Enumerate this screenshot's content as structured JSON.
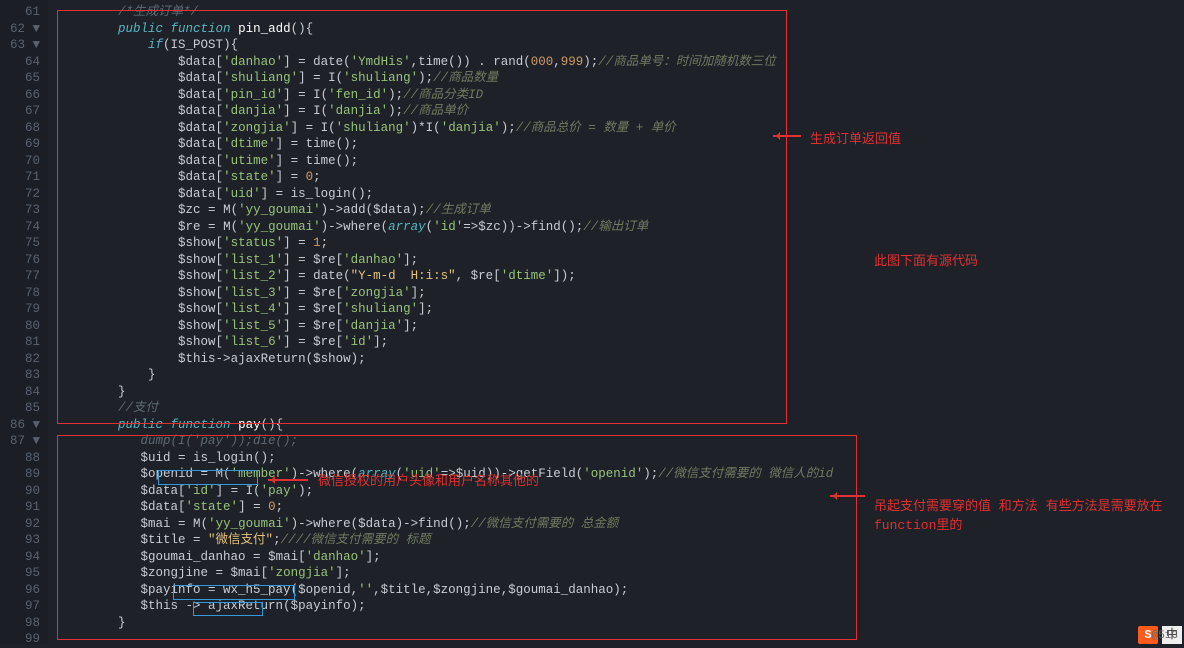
{
  "line_start": 61,
  "fold_lines": [
    62,
    63,
    86,
    87
  ],
  "annotations": {
    "label1": "生成订单返回值",
    "label2": "此图下面有源代码",
    "label3": "微信授权的用户头像和用户名称其他的",
    "label4": "吊起支付需要穿的值   和方法  有些方法是需要放在function里的"
  },
  "watermark": "@51C",
  "code": [
    {
      "i": "        ",
      "t": [
        [
          "cm",
          "/*生成订单*/"
        ]
      ]
    },
    {
      "i": "        ",
      "t": [
        [
          "kw",
          "public"
        ],
        [
          "op",
          " "
        ],
        [
          "kw",
          "function"
        ],
        [
          "op",
          " "
        ],
        [
          "fn",
          "pin_add"
        ],
        [
          "op",
          "(){"
        ]
      ]
    },
    {
      "i": "            ",
      "t": [
        [
          "kw",
          "if"
        ],
        [
          "op",
          "("
        ],
        [
          "var",
          "IS_POST"
        ],
        [
          "op",
          "){"
        ]
      ]
    },
    {
      "i": "                ",
      "t": [
        [
          "var",
          "$data"
        ],
        [
          "op",
          "["
        ],
        [
          "str",
          "'danhao'"
        ],
        [
          "op",
          "] = "
        ],
        [
          "call",
          "date"
        ],
        [
          "op",
          "("
        ],
        [
          "str",
          "'YmdHis'"
        ],
        [
          "op",
          ","
        ],
        [
          "call",
          "time"
        ],
        [
          "op",
          "()) . "
        ],
        [
          "call",
          "rand"
        ],
        [
          "op",
          "("
        ],
        [
          "num",
          "000"
        ],
        [
          "op",
          ","
        ],
        [
          "num",
          "999"
        ],
        [
          "op",
          ");"
        ],
        [
          "cm-g",
          "//商品单号：时间加随机数三位"
        ]
      ]
    },
    {
      "i": "                ",
      "t": [
        [
          "var",
          "$data"
        ],
        [
          "op",
          "["
        ],
        [
          "str",
          "'shuliang'"
        ],
        [
          "op",
          "] = "
        ],
        [
          "call",
          "I"
        ],
        [
          "op",
          "("
        ],
        [
          "str",
          "'shuliang'"
        ],
        [
          "op",
          ");"
        ],
        [
          "cm-g",
          "//商品数量"
        ]
      ]
    },
    {
      "i": "                ",
      "t": [
        [
          "var",
          "$data"
        ],
        [
          "op",
          "["
        ],
        [
          "str",
          "'pin_id'"
        ],
        [
          "op",
          "] = "
        ],
        [
          "call",
          "I"
        ],
        [
          "op",
          "("
        ],
        [
          "str",
          "'fen_id'"
        ],
        [
          "op",
          ");"
        ],
        [
          "cm-g",
          "//商品分类ID"
        ]
      ]
    },
    {
      "i": "                ",
      "t": [
        [
          "var",
          "$data"
        ],
        [
          "op",
          "["
        ],
        [
          "str",
          "'danjia'"
        ],
        [
          "op",
          "] = "
        ],
        [
          "call",
          "I"
        ],
        [
          "op",
          "("
        ],
        [
          "str",
          "'danjia'"
        ],
        [
          "op",
          ");"
        ],
        [
          "cm-g",
          "//商品单价"
        ]
      ]
    },
    {
      "i": "                ",
      "t": [
        [
          "var",
          "$data"
        ],
        [
          "op",
          "["
        ],
        [
          "str",
          "'zongjia'"
        ],
        [
          "op",
          "] = "
        ],
        [
          "call",
          "I"
        ],
        [
          "op",
          "("
        ],
        [
          "str",
          "'shuliang'"
        ],
        [
          "op",
          ")*"
        ],
        [
          "call",
          "I"
        ],
        [
          "op",
          "("
        ],
        [
          "str",
          "'danjia'"
        ],
        [
          "op",
          ");"
        ],
        [
          "cm-g",
          "//商品总价 = 数量 + 单价"
        ]
      ]
    },
    {
      "i": "                ",
      "t": [
        [
          "var",
          "$data"
        ],
        [
          "op",
          "["
        ],
        [
          "str",
          "'dtime'"
        ],
        [
          "op",
          "] = "
        ],
        [
          "call",
          "time"
        ],
        [
          "op",
          "();"
        ]
      ]
    },
    {
      "i": "                ",
      "t": [
        [
          "var",
          "$data"
        ],
        [
          "op",
          "["
        ],
        [
          "str",
          "'utime'"
        ],
        [
          "op",
          "] = "
        ],
        [
          "call",
          "time"
        ],
        [
          "op",
          "();"
        ]
      ]
    },
    {
      "i": "                ",
      "t": [
        [
          "var",
          "$data"
        ],
        [
          "op",
          "["
        ],
        [
          "str",
          "'state'"
        ],
        [
          "op",
          "] = "
        ],
        [
          "num",
          "0"
        ],
        [
          "op",
          ";"
        ]
      ]
    },
    {
      "i": "                ",
      "t": [
        [
          "var",
          "$data"
        ],
        [
          "op",
          "["
        ],
        [
          "str",
          "'uid'"
        ],
        [
          "op",
          "] = "
        ],
        [
          "call",
          "is_login"
        ],
        [
          "op",
          "();"
        ]
      ]
    },
    {
      "i": "                ",
      "t": [
        [
          "var",
          "$zc"
        ],
        [
          "op",
          " = "
        ],
        [
          "call",
          "M"
        ],
        [
          "op",
          "("
        ],
        [
          "str",
          "'yy_goumai'"
        ],
        [
          "op",
          ")->"
        ],
        [
          "call",
          "add"
        ],
        [
          "op",
          "("
        ],
        [
          "var",
          "$data"
        ],
        [
          "op",
          ");"
        ],
        [
          "cm-g",
          "//生成订单"
        ]
      ]
    },
    {
      "i": "                ",
      "t": [
        [
          "var",
          "$re"
        ],
        [
          "op",
          " = "
        ],
        [
          "call",
          "M"
        ],
        [
          "op",
          "("
        ],
        [
          "str",
          "'yy_goumai'"
        ],
        [
          "op",
          ")->"
        ],
        [
          "call",
          "where"
        ],
        [
          "op",
          "("
        ],
        [
          "kw",
          "array"
        ],
        [
          "op",
          "("
        ],
        [
          "str",
          "'id'"
        ],
        [
          "op",
          "=>"
        ],
        [
          "var",
          "$zc"
        ],
        [
          "op",
          "))->"
        ],
        [
          "call",
          "find"
        ],
        [
          "op",
          "();"
        ],
        [
          "cm-g",
          "//输出订单"
        ]
      ]
    },
    {
      "i": "                ",
      "t": [
        [
          "var",
          "$show"
        ],
        [
          "op",
          "["
        ],
        [
          "str",
          "'status'"
        ],
        [
          "op",
          "] = "
        ],
        [
          "num",
          "1"
        ],
        [
          "op",
          ";"
        ]
      ]
    },
    {
      "i": "                ",
      "t": [
        [
          "var",
          "$show"
        ],
        [
          "op",
          "["
        ],
        [
          "str",
          "'list_1'"
        ],
        [
          "op",
          "] = "
        ],
        [
          "var",
          "$re"
        ],
        [
          "op",
          "["
        ],
        [
          "str",
          "'danhao'"
        ],
        [
          "op",
          "];"
        ]
      ]
    },
    {
      "i": "                ",
      "t": [
        [
          "var",
          "$show"
        ],
        [
          "op",
          "["
        ],
        [
          "str",
          "'list_2'"
        ],
        [
          "op",
          "] = "
        ],
        [
          "call",
          "date"
        ],
        [
          "op",
          "("
        ],
        [
          "str-y",
          "\"Y-m-d  H:i:s\""
        ],
        [
          "op",
          ", "
        ],
        [
          "var",
          "$re"
        ],
        [
          "op",
          "["
        ],
        [
          "str",
          "'dtime'"
        ],
        [
          "op",
          "]);"
        ]
      ]
    },
    {
      "i": "                ",
      "t": [
        [
          "var",
          "$show"
        ],
        [
          "op",
          "["
        ],
        [
          "str",
          "'list_3'"
        ],
        [
          "op",
          "] = "
        ],
        [
          "var",
          "$re"
        ],
        [
          "op",
          "["
        ],
        [
          "str",
          "'zongjia'"
        ],
        [
          "op",
          "];"
        ]
      ]
    },
    {
      "i": "                ",
      "t": [
        [
          "var",
          "$show"
        ],
        [
          "op",
          "["
        ],
        [
          "str",
          "'list_4'"
        ],
        [
          "op",
          "] = "
        ],
        [
          "var",
          "$re"
        ],
        [
          "op",
          "["
        ],
        [
          "str",
          "'shuliang'"
        ],
        [
          "op",
          "];"
        ]
      ]
    },
    {
      "i": "                ",
      "t": [
        [
          "var",
          "$show"
        ],
        [
          "op",
          "["
        ],
        [
          "str",
          "'list_5'"
        ],
        [
          "op",
          "] = "
        ],
        [
          "var",
          "$re"
        ],
        [
          "op",
          "["
        ],
        [
          "str",
          "'danjia'"
        ],
        [
          "op",
          "];"
        ]
      ]
    },
    {
      "i": "                ",
      "t": [
        [
          "var",
          "$show"
        ],
        [
          "op",
          "["
        ],
        [
          "str",
          "'list_6'"
        ],
        [
          "op",
          "] = "
        ],
        [
          "var",
          "$re"
        ],
        [
          "op",
          "["
        ],
        [
          "str",
          "'id'"
        ],
        [
          "op",
          "];"
        ]
      ]
    },
    {
      "i": "                ",
      "t": [
        [
          "var",
          "$this"
        ],
        [
          "op",
          "->"
        ],
        [
          "call",
          "ajaxReturn"
        ],
        [
          "op",
          "("
        ],
        [
          "var",
          "$show"
        ],
        [
          "op",
          ");"
        ]
      ]
    },
    {
      "i": "            ",
      "t": [
        [
          "op",
          "}"
        ]
      ]
    },
    {
      "i": "        ",
      "t": [
        [
          "op",
          "}"
        ]
      ]
    },
    {
      "i": "        ",
      "t": [
        [
          "cm",
          "//支付"
        ]
      ]
    },
    {
      "i": "        ",
      "t": [
        [
          "kw",
          "public"
        ],
        [
          "op",
          " "
        ],
        [
          "kw",
          "function"
        ],
        [
          "op",
          " "
        ],
        [
          "fn",
          "pay"
        ],
        [
          "op",
          "(){"
        ]
      ]
    },
    {
      "i": "           ",
      "t": [
        [
          "cm",
          "dump(I('pay'));die();"
        ]
      ]
    },
    {
      "i": "           ",
      "t": [
        [
          "var",
          "$uid"
        ],
        [
          "op",
          " = "
        ],
        [
          "call",
          "is_login"
        ],
        [
          "op",
          "();"
        ]
      ]
    },
    {
      "i": "           ",
      "t": [
        [
          "var",
          "$openid"
        ],
        [
          "op",
          " = "
        ],
        [
          "call",
          "M"
        ],
        [
          "op",
          "("
        ],
        [
          "str",
          "'member'"
        ],
        [
          "op",
          ")->"
        ],
        [
          "call",
          "where"
        ],
        [
          "op",
          "("
        ],
        [
          "kw",
          "array"
        ],
        [
          "op",
          "("
        ],
        [
          "str",
          "'uid'"
        ],
        [
          "op",
          "=>"
        ],
        [
          "var",
          "$uid"
        ],
        [
          "op",
          "))->"
        ],
        [
          "call",
          "getField"
        ],
        [
          "op",
          "("
        ],
        [
          "str",
          "'openid'"
        ],
        [
          "op",
          ");"
        ],
        [
          "cm-g",
          "//微信支付需要的 微信人的id"
        ]
      ]
    },
    {
      "i": "           ",
      "t": [
        [
          "var",
          "$data"
        ],
        [
          "op",
          "["
        ],
        [
          "str",
          "'id'"
        ],
        [
          "op",
          "] = "
        ],
        [
          "call",
          "I"
        ],
        [
          "op",
          "("
        ],
        [
          "str",
          "'pay'"
        ],
        [
          "op",
          ");"
        ]
      ]
    },
    {
      "i": "           ",
      "t": [
        [
          "var",
          "$data"
        ],
        [
          "op",
          "["
        ],
        [
          "str",
          "'state'"
        ],
        [
          "op",
          "] = "
        ],
        [
          "num",
          "0"
        ],
        [
          "op",
          ";"
        ]
      ]
    },
    {
      "i": "           ",
      "t": [
        [
          "var",
          "$mai"
        ],
        [
          "op",
          " = "
        ],
        [
          "call",
          "M"
        ],
        [
          "op",
          "("
        ],
        [
          "str",
          "'yy_goumai'"
        ],
        [
          "op",
          ")->"
        ],
        [
          "call",
          "where"
        ],
        [
          "op",
          "("
        ],
        [
          "var",
          "$data"
        ],
        [
          "op",
          ")->"
        ],
        [
          "call",
          "find"
        ],
        [
          "op",
          "();"
        ],
        [
          "cm-g",
          "//微信支付需要的 总金额"
        ]
      ]
    },
    {
      "i": "           ",
      "t": [
        [
          "var",
          "$title"
        ],
        [
          "op",
          " = "
        ],
        [
          "str-y",
          "\"微信支付\""
        ],
        [
          "op",
          ";"
        ],
        [
          "cm-g",
          "////微信支付需要的 标题"
        ]
      ]
    },
    {
      "i": "           ",
      "t": [
        [
          "var",
          "$goumai_danhao"
        ],
        [
          "op",
          " = "
        ],
        [
          "var",
          "$mai"
        ],
        [
          "op",
          "["
        ],
        [
          "str",
          "'danhao'"
        ],
        [
          "op",
          "];"
        ]
      ]
    },
    {
      "i": "           ",
      "t": [
        [
          "var",
          "$zongjine"
        ],
        [
          "op",
          " = "
        ],
        [
          "var",
          "$mai"
        ],
        [
          "op",
          "["
        ],
        [
          "str",
          "'zongjia'"
        ],
        [
          "op",
          "];"
        ]
      ]
    },
    {
      "i": "           ",
      "t": [
        [
          "var",
          "$payinfo"
        ],
        [
          "op",
          " = "
        ],
        [
          "call",
          "wx_h5_pay"
        ],
        [
          "op",
          "("
        ],
        [
          "var",
          "$openid"
        ],
        [
          "op",
          ","
        ],
        [
          "str",
          "''"
        ],
        [
          "op",
          ","
        ],
        [
          "var",
          "$title"
        ],
        [
          "op",
          ","
        ],
        [
          "var",
          "$zongjine"
        ],
        [
          "op",
          ","
        ],
        [
          "var",
          "$goumai_danhao"
        ],
        [
          "op",
          ");"
        ]
      ]
    },
    {
      "i": "           ",
      "t": [
        [
          "var",
          "$this"
        ],
        [
          "op",
          " -> "
        ],
        [
          "call",
          "ajaxReturn"
        ],
        [
          "op",
          "("
        ],
        [
          "var",
          "$payinfo"
        ],
        [
          "op",
          ");"
        ]
      ]
    },
    {
      "i": "        ",
      "t": [
        [
          "op",
          "}"
        ]
      ]
    },
    {
      "i": "",
      "t": []
    }
  ]
}
